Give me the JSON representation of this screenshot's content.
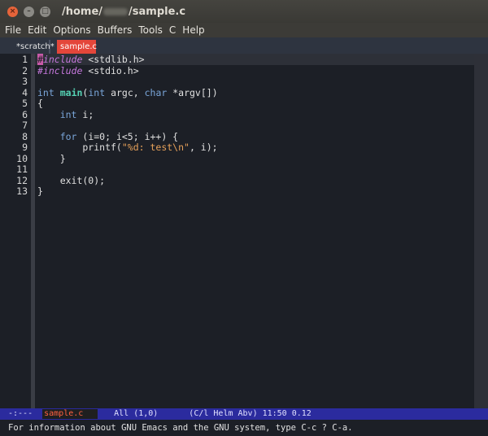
{
  "window": {
    "title_prefix": "/home/",
    "title_suffix": "/sample.c"
  },
  "menubar": {
    "items": [
      "File",
      "Edit",
      "Options",
      "Buffers",
      "Tools",
      "C",
      "Help"
    ]
  },
  "tabs": [
    {
      "label": "*scratch*",
      "active": false
    },
    {
      "label": "sample.c",
      "active": true
    }
  ],
  "editor": {
    "line_numbers": [
      "1",
      "2",
      "3",
      "4",
      "5",
      "6",
      "7",
      "8",
      "9",
      "10",
      "11",
      "12",
      "13"
    ],
    "lines": [
      [
        {
          "t": "#",
          "c": "cursor"
        },
        {
          "t": "include",
          "c": "pp"
        },
        {
          "t": " <stdlib.h>",
          "c": ""
        }
      ],
      [
        {
          "t": "#include",
          "c": "pp"
        },
        {
          "t": " <stdio.h>",
          "c": ""
        }
      ],
      [],
      [
        {
          "t": "int",
          "c": "ty"
        },
        {
          "t": " ",
          "c": ""
        },
        {
          "t": "main",
          "c": "fn"
        },
        {
          "t": "(",
          "c": ""
        },
        {
          "t": "int",
          "c": "ty"
        },
        {
          "t": " argc, ",
          "c": ""
        },
        {
          "t": "char",
          "c": "ty"
        },
        {
          "t": " *argv[])",
          "c": ""
        }
      ],
      [
        {
          "t": "{",
          "c": ""
        }
      ],
      [
        {
          "t": "    ",
          "c": ""
        },
        {
          "t": "int",
          "c": "ty"
        },
        {
          "t": " i;",
          "c": ""
        }
      ],
      [],
      [
        {
          "t": "    ",
          "c": ""
        },
        {
          "t": "for",
          "c": "kw"
        },
        {
          "t": " (i=0; i<5; i++) {",
          "c": ""
        }
      ],
      [
        {
          "t": "        printf(",
          "c": ""
        },
        {
          "t": "\"%d: test\\n\"",
          "c": "str"
        },
        {
          "t": ", i);",
          "c": ""
        }
      ],
      [
        {
          "t": "    }",
          "c": ""
        }
      ],
      [],
      [
        {
          "t": "    exit(0);",
          "c": ""
        }
      ],
      [
        {
          "t": "}",
          "c": ""
        }
      ]
    ]
  },
  "modeline": {
    "status": "-:---",
    "buffer": "sample.c",
    "position": "All (1,0)",
    "mode": "(C/l Helm Abv)",
    "time": "11:50 0.12"
  },
  "echo": {
    "message": "For information about GNU Emacs and the GNU system, type C-c ? C-a."
  }
}
